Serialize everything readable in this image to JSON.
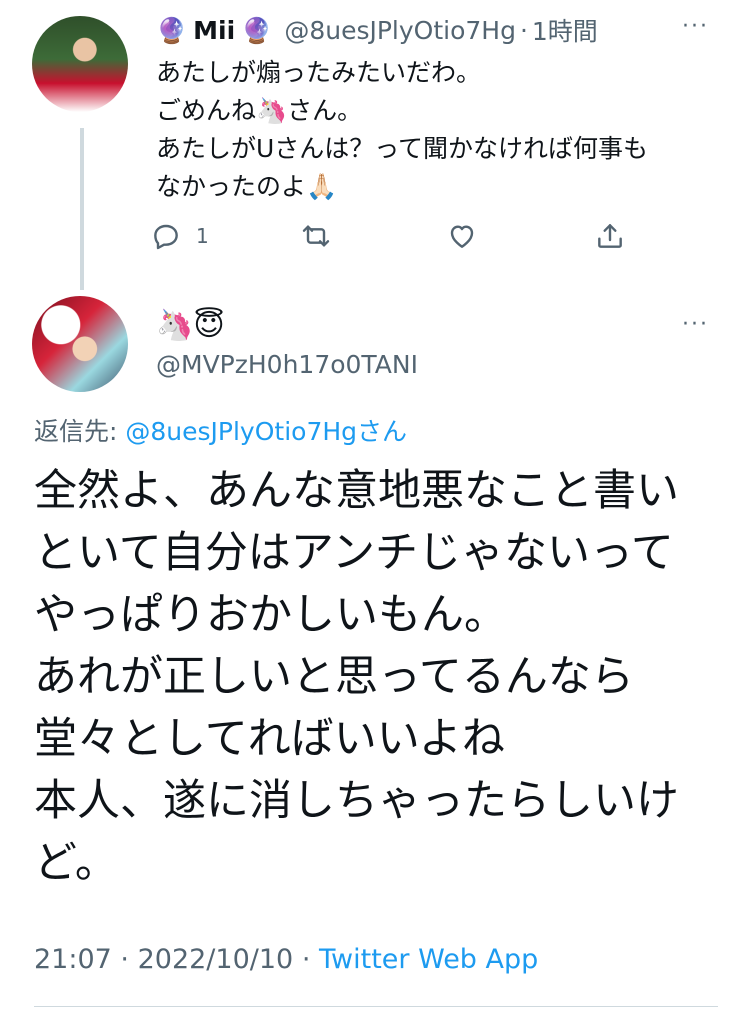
{
  "tweet1": {
    "name_prefix_emoji": "🔮",
    "display_name": "Mii",
    "name_suffix_emoji": "🔮",
    "handle": "@8uesJPlyOtio7Hg",
    "separator": "·",
    "time": "1時間",
    "text_line1": "あたしが煽ったみたいだわ。",
    "text_line2": "ごめんね🦄さん。",
    "text_line3": "あたしがUさんは？って聞かなければ何事も",
    "text_line4": "なかったのよ🙏🏻",
    "reply_count": "1",
    "more_label": "···"
  },
  "tweet2": {
    "display_name": "🦄😇",
    "handle": "@MVPzH0h17o0TANI",
    "more_label": "···",
    "reply_prefix": "返信先: ",
    "reply_to": "@8uesJPlyOtio7Hgさん",
    "text": "全然よ、あんな意地悪なこと書い\nといて自分はアンチじゃないって\nやっぱりおかしいもん。\nあれが正しいと思ってるんなら\n堂々としてればいいよね\n本人、遂に消しちゃったらしいけ\nど。",
    "time": "21:07",
    "date": "2022/10/10",
    "dot": "·",
    "source": "Twitter Web App"
  },
  "icons": {
    "reply": "reply-icon",
    "retweet": "retweet-icon",
    "like": "heart-icon",
    "share": "share-icon",
    "more": "more-icon"
  },
  "colors": {
    "accent": "#1d9bf0",
    "muted": "#536471",
    "divider": "#cfd9de"
  }
}
